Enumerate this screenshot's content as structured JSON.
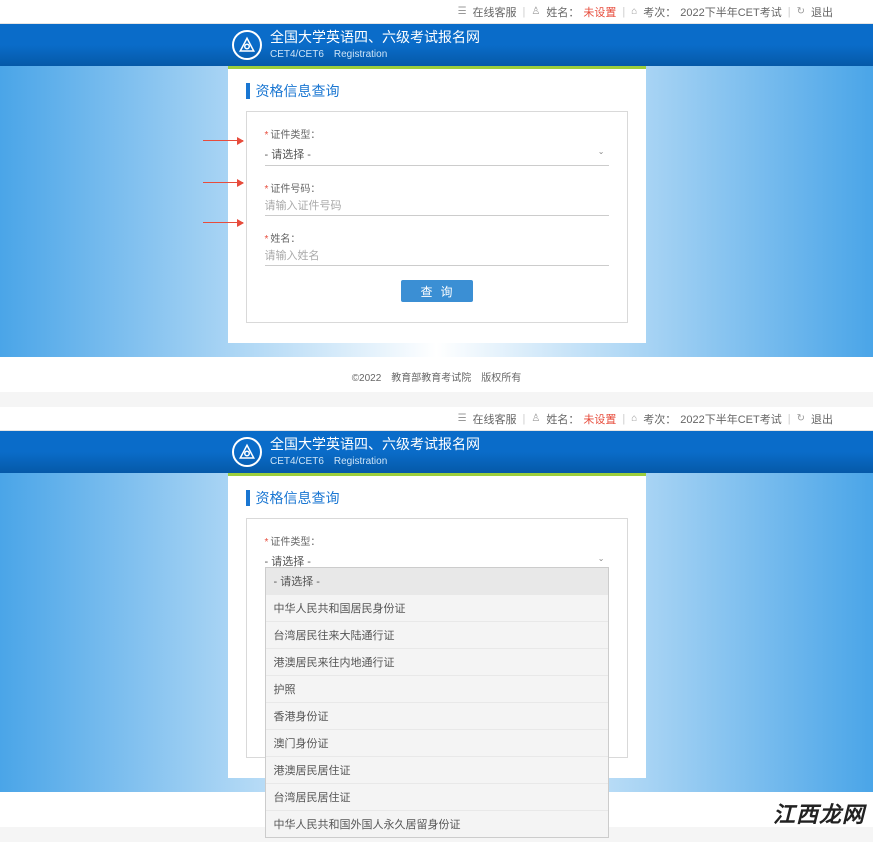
{
  "topbar": {
    "online_service": "在线客服",
    "name_label": "姓名：",
    "name_value": "未设置",
    "exam_label": "考次：",
    "exam_value": "2022下半年CET考试",
    "logout": "退出"
  },
  "header": {
    "title": "全国大学英语四、六级考试报名网",
    "subtitle": "CET4/CET6　Registration"
  },
  "panel": {
    "heading": "资格信息查询"
  },
  "form": {
    "id_type_label": "证件类型：",
    "id_type_value": "- 请选择 -",
    "id_number_label": "证件号码：",
    "id_number_placeholder": "请输入证件号码",
    "name_label": "姓名：",
    "name_placeholder": "请输入姓名",
    "query_btn": "查询"
  },
  "dropdown_options": [
    "- 请选择 -",
    "中华人民共和国居民身份证",
    "台湾居民往来大陆通行证",
    "港澳居民来往内地通行证",
    "护照",
    "香港身份证",
    "澳门身份证",
    "港澳居民居住证",
    "台湾居民居住证",
    "中华人民共和国外国人永久居留身份证"
  ],
  "footer": "©2022　教育部教育考试院　版权所有",
  "watermark": "江西龙网"
}
